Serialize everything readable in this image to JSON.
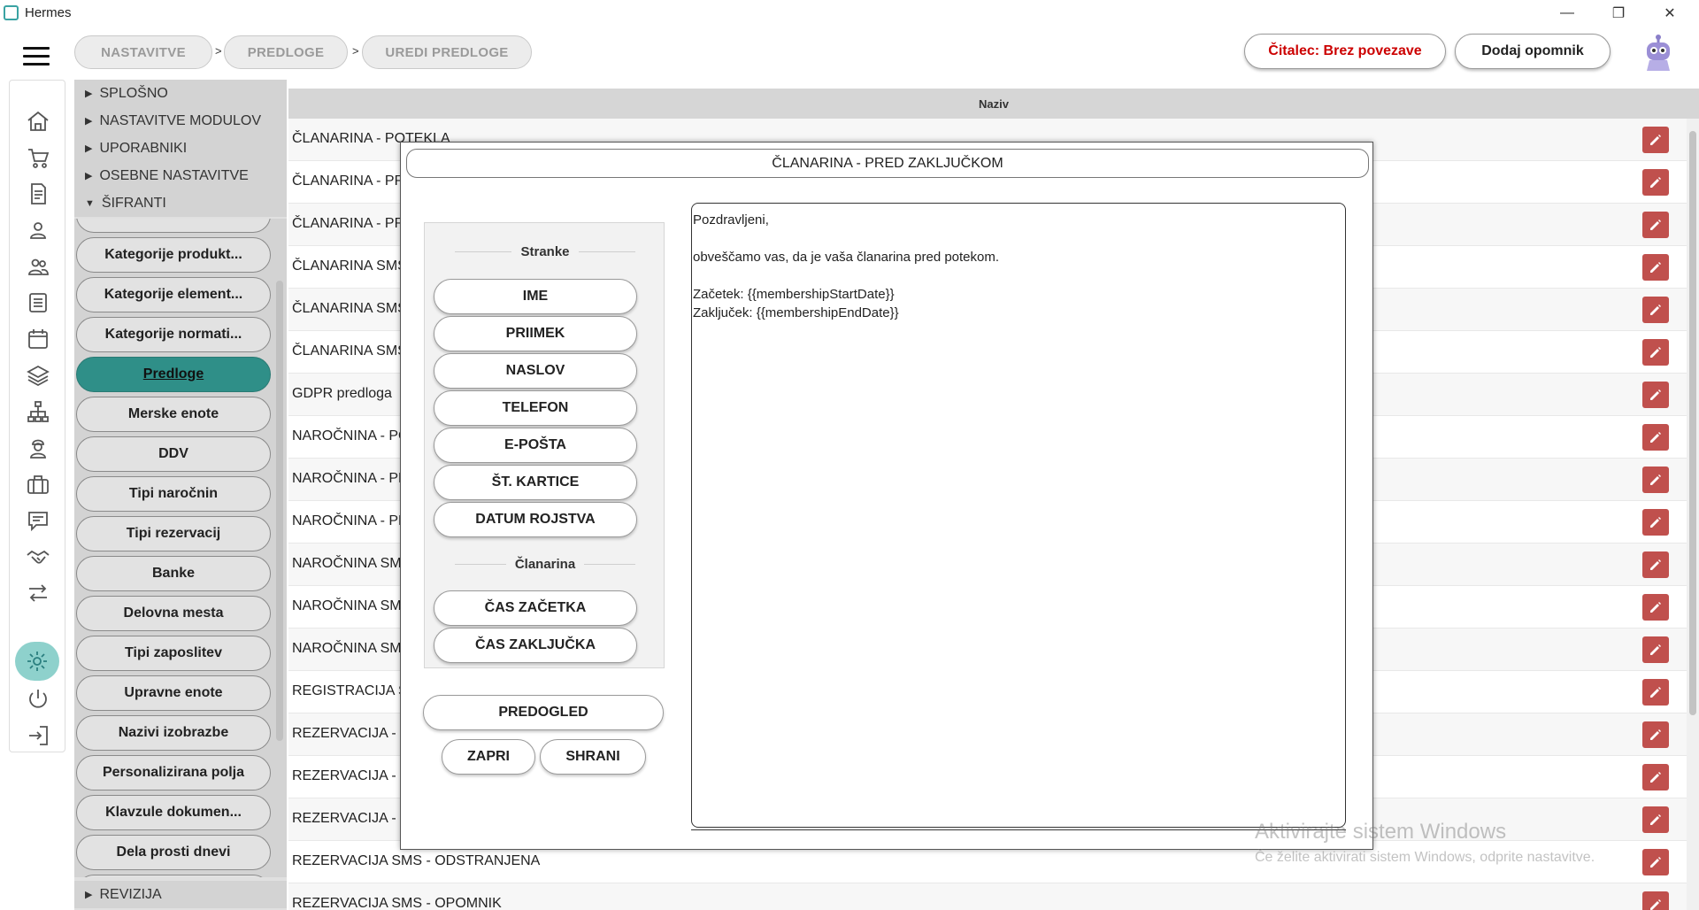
{
  "window": {
    "title": "Hermes",
    "controls": {
      "minimize": "—",
      "restore": "❐",
      "close": "✕"
    }
  },
  "header": {
    "breadcrumbs": [
      "NASTAVITVE",
      "PREDLOGE",
      "UREDI PREDLOGE"
    ],
    "separator": ">",
    "reader_status": "Čitalec: Brez povezave",
    "reader_status_color": "#cc0000",
    "add_reminder": "Dodaj opomnik"
  },
  "rail": {
    "icons": [
      "home-icon",
      "cart-icon",
      "document-icon",
      "person-icon",
      "people-icon",
      "list-icon",
      "calendar-icon",
      "layers-icon",
      "network-icon",
      "worker-icon",
      "briefcase-icon",
      "chat-icon",
      "handshake-icon",
      "transfer-icon",
      "gear-icon",
      "power-icon",
      "logout-icon"
    ],
    "active": "gear-icon"
  },
  "tree": {
    "sections": [
      "SPLOŠNO",
      "NASTAVITVE MODULOV",
      "UPORABNIKI",
      "OSEBNE NASTAVITVE",
      "ŠIFRANTI"
    ],
    "bottom_section": "REVIZIJA",
    "items": [
      "Kategorije produkt...",
      "Kategorije element...",
      "Kategorije normati...",
      "Predloge",
      "Merske enote",
      "DDV",
      "Tipi naročnin",
      "Tipi rezervacij",
      "Banke",
      "Delovna mesta",
      "Tipi zaposlitev",
      "Upravne enote",
      "Nazivi izobrazbe",
      "Personalizirana polja",
      "Klavzule dokumen...",
      "Dela prosti dnevi"
    ],
    "active_item": "Predloge"
  },
  "table": {
    "column": "Naziv",
    "rows": [
      "ČLANARINA - POTEKLA",
      "ČLANARINA - PRE",
      "ČLANARINA - PRE",
      "ČLANARINA SMS -",
      "ČLANARINA SMS -",
      "ČLANARINA SMS -",
      "GDPR predloga",
      "NAROČNINA - PO",
      "NAROČNINA - PRE",
      "NAROČNINA - PRE",
      "NAROČNINA SMS",
      "NAROČNINA SMS",
      "NAROČNINA SMS",
      "REGISTRACIJA STR",
      "REZERVACIJA - OD",
      "REZERVACIJA - OP",
      "REZERVACIJA - PR",
      "REZERVACIJA SMS - ODSTRANJENA",
      "REZERVACIJA SMS - OPOMNIK"
    ],
    "edit_color": "#c0504d"
  },
  "modal": {
    "title": "ČLANARINA - PRED ZAKLJUČKOM",
    "groups": [
      {
        "label": "Stranke",
        "buttons": [
          "IME",
          "PRIIMEK",
          "NASLOV",
          "TELEFON",
          "E-POŠTA",
          "ŠT. KARTICE",
          "DATUM ROJSTVA"
        ]
      },
      {
        "label": "Članarina",
        "buttons": [
          "ČAS ZAČETKA",
          "ČAS ZAKLJUČKA"
        ]
      }
    ],
    "preview": "PREDOGLED",
    "close": "ZAPRI",
    "save": "SHRANI",
    "body_lines": [
      "Pozdravljeni,",
      "",
      "obveščamo vas, da je vaša članarina pred potekom.",
      "",
      "Začetek: {{membershipStartDate}}",
      "Zaključek: {{membershipEndDate}}"
    ]
  },
  "watermark": {
    "line1": "Aktivirajte sistem Windows",
    "line2": "Če želite aktivirati sistem Windows, odprite nastavitve."
  }
}
